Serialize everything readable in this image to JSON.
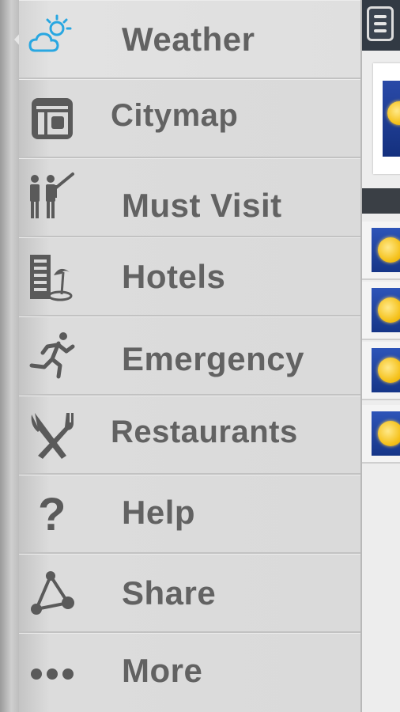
{
  "menu": {
    "items": [
      {
        "label": "Weather",
        "icon": "weather-icon",
        "active": true
      },
      {
        "label": "Citymap",
        "icon": "citymap-icon",
        "active": false
      },
      {
        "label": "Must Visit",
        "icon": "must-visit-icon",
        "active": false
      },
      {
        "label": "Hotels",
        "icon": "hotels-icon",
        "active": false
      },
      {
        "label": "Emergency",
        "icon": "emergency-icon",
        "active": false
      },
      {
        "label": "Restaurants",
        "icon": "restaurants-icon",
        "active": false
      },
      {
        "label": "Help",
        "icon": "help-icon",
        "active": false
      },
      {
        "label": "Share",
        "icon": "share-icon",
        "active": false
      },
      {
        "label": "More",
        "icon": "more-icon",
        "active": false
      }
    ]
  },
  "right_panel": {
    "menu_button_icon": "hamburger-menu-icon",
    "weather_icon": "sun-icon"
  },
  "colors": {
    "active_icon": "#29a7e1",
    "label_text": "#626262",
    "icon_gray": "#5a5a5a",
    "top_bar": "#323a44"
  }
}
